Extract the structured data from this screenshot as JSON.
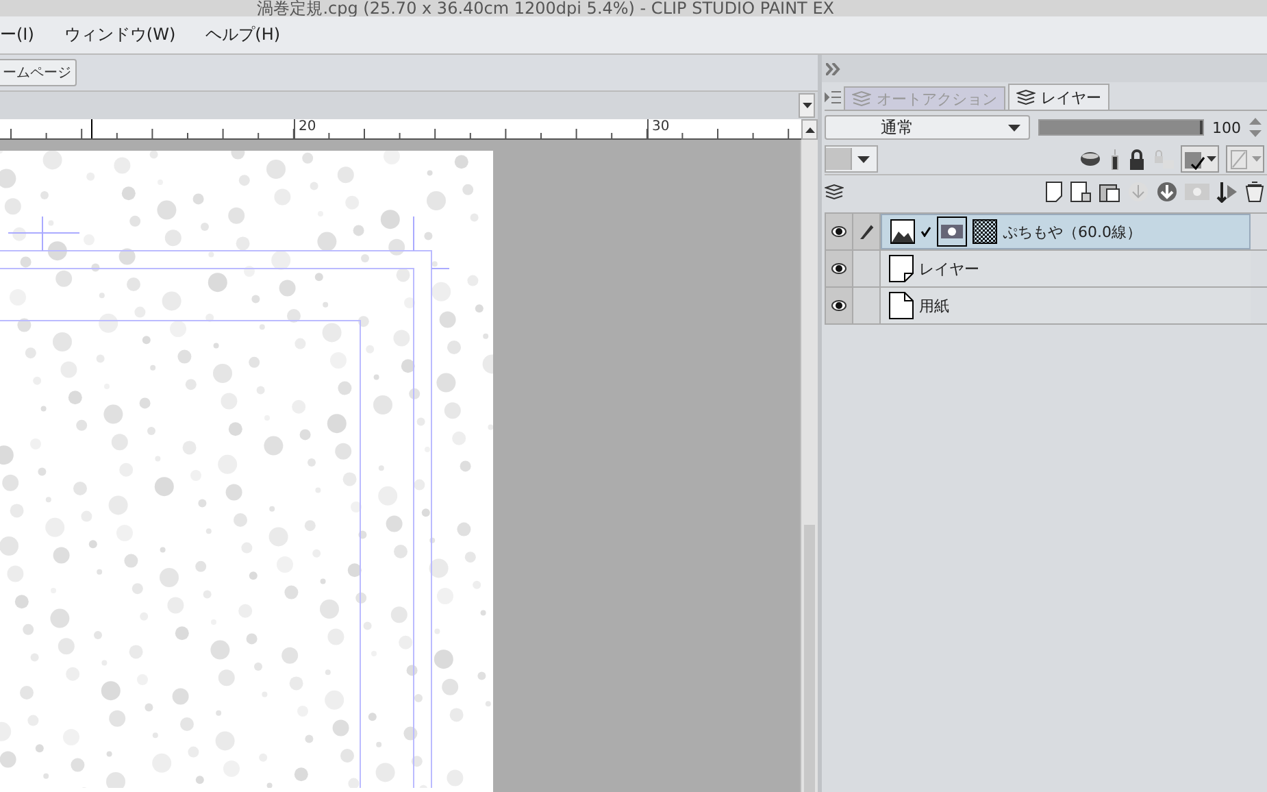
{
  "window": {
    "title": "渦巻定規.cpg (25.70 x 36.40cm 1200dpi 5.4%)  - CLIP STUDIO PAINT EX"
  },
  "menu": [
    "ー(I)",
    "ウィンドウ(W)",
    "ヘルプ(H)"
  ],
  "toolbar": {
    "button": "ームページ"
  },
  "ruler": {
    "labels": [
      "20",
      "30"
    ]
  },
  "panel": {
    "tabs": [
      {
        "label": "オートアクション",
        "selected": false
      },
      {
        "label": "レイヤー",
        "selected": true
      }
    ],
    "blend_mode": "通常",
    "opacity": {
      "level": 1,
      "reading": "100"
    },
    "layers": [
      {
        "name": "ぷちもや（60.0線）",
        "kind": "tone",
        "visible": true,
        "editing": true,
        "selected": true
      },
      {
        "name": "レイヤー",
        "kind": "raster",
        "visible": true,
        "editing": false,
        "selected": false
      },
      {
        "name": "用紙",
        "kind": "paper",
        "visible": true,
        "editing": false,
        "selected": false
      }
    ]
  }
}
